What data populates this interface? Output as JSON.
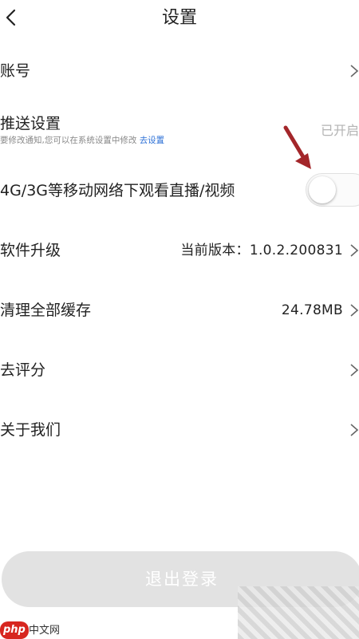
{
  "header": {
    "title": "设置",
    "back_icon": "chevron-left-icon"
  },
  "rows": [
    {
      "label": "账号"
    },
    {
      "label": "推送设置",
      "sub_text": "要修改通知,您可以在系统设置中修改",
      "sub_link": "去设置",
      "status": "已开启"
    },
    {
      "label": "4G/3G等移动网络下观看直播/视频",
      "toggle_on": false
    },
    {
      "label": "软件升级",
      "value": "当前版本：1.0.2.200831"
    },
    {
      "label": "清理全部缓存",
      "value": "24.78MB"
    },
    {
      "label": "去评分"
    },
    {
      "label": "关于我们"
    }
  ],
  "logout_label": "退出登录",
  "colors": {
    "link": "#2b6fd6",
    "annotation_arrow": "#a3262a",
    "logout_bg": "#e2e2e2",
    "php_badge": "#d7261f"
  },
  "watermark": {
    "badge": "php",
    "text": "中文网"
  }
}
